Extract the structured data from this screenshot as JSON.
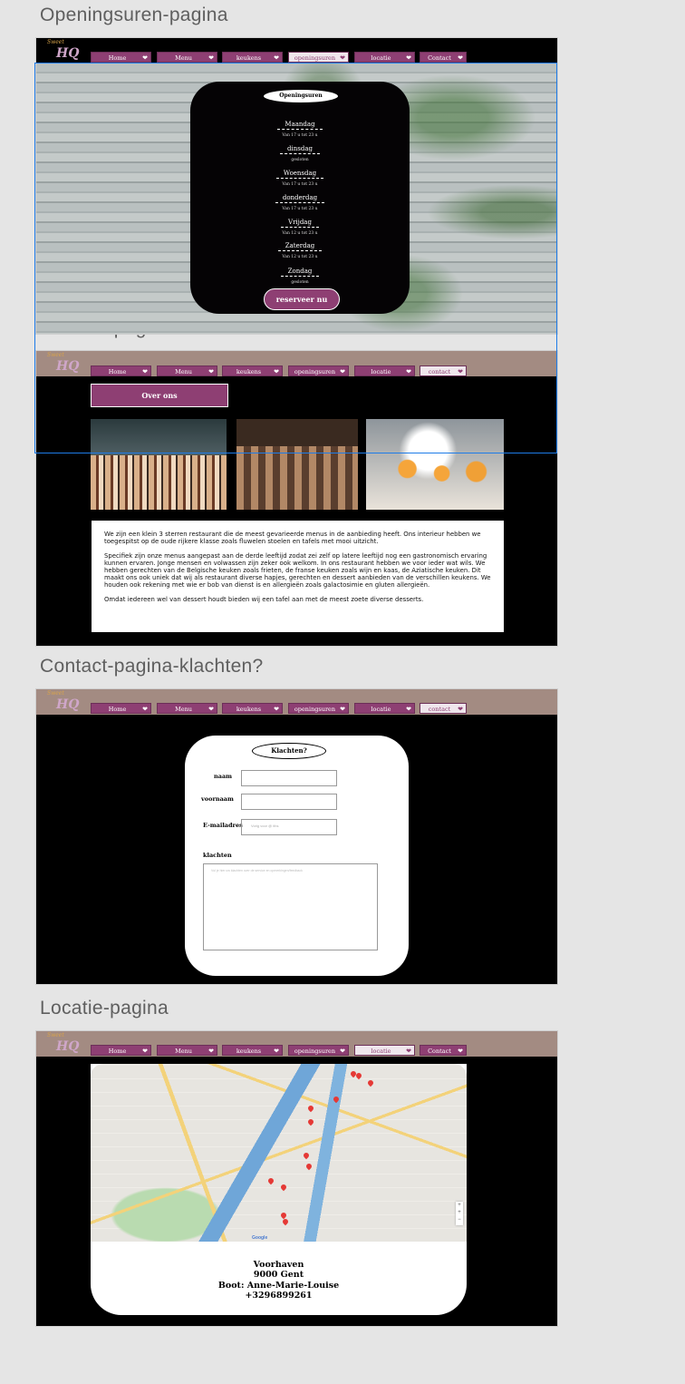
{
  "artboards": {
    "openingsuren": "Openingsuren-pagina",
    "over_ons": "Contact-pagina-over ons",
    "klachten": "Contact-pagina-klachten?",
    "locatie": "Locatie-pagina"
  },
  "logo": {
    "line1": "Sweet",
    "line2": "HQ"
  },
  "nav": {
    "home": "Home",
    "menu": "Menu",
    "keukens": "keukens",
    "openingsuren": "openingsuren",
    "locatie": "locatie",
    "contact_cap": "Contact",
    "contact_low": "contact"
  },
  "hours": {
    "title": "Openingsuren",
    "days": [
      {
        "name": "Maandag",
        "time": "Van 17 u tot 23 u"
      },
      {
        "name": "dinsdag",
        "time": "gesloten"
      },
      {
        "name": "Woensdag",
        "time": "Van 17 u tot 23 u"
      },
      {
        "name": "donderdag",
        "time": "Van 17 u tot 23 u"
      },
      {
        "name": "Vrijdag",
        "time": "Van 12 u tot 23 u"
      },
      {
        "name": "Zaterdag",
        "time": "Van 12 u tot 23 u"
      },
      {
        "name": "Zondag",
        "time": "gesloten"
      }
    ],
    "reserve": "reserveer nu"
  },
  "about": {
    "button": "Over ons",
    "p1": "We zijn een klein 3 sterren restaurant die de meest gevarieerde menus in de aanbieding heeft. Ons interieur hebben we toegespitst op de oude rijkere klasse zoals fluwelen stoelen en tafels met mooi uitzicht.",
    "p2": "Specifiek zijn onze menus aangepast aan de derde leeftijd zodat zei zelf op latere leeftijd nog een gastronomisch ervaring kunnen ervaren. Jonge mensen en volwassen zijn zeker ook welkom. In ons restaurant hebben we voor ieder wat wils. We hebben gerechten van de Belgische keuken zoals frieten, de franse keuken zoals wijn en kaas, de Aziatische keuken. Dit maakt ons ook uniek dat wij als restaurant diverse hapjes, gerechten en dessert aanbieden van de verschillen keukens. We houden ook rekening met wie er bob van dienst is en allergieën zoals galactosimie en gluten allergieën.",
    "p3": "Omdat iedereen wel van dessert houdt bieden wij een tafel aan met de meest zoete diverse desserts."
  },
  "complaints": {
    "title": "Klachten?",
    "naam": "naam",
    "voornaam": "voornaam",
    "email": "E-mailadres",
    "email_placeholder": "Vorig voor @ iths",
    "klachten": "klachten",
    "textarea_placeholder": "Vul je hier uw klachten over de service en opmerkingen/feedback"
  },
  "location": {
    "line1": "Voorhaven",
    "line2": "9000 Gent",
    "line3": "Boot: Anne-Marie-Louise",
    "line4": "+3296899261",
    "google": "Google"
  },
  "colors": {
    "accent": "#8e3f73",
    "taupe": "#a38b82",
    "selection": "#1e7ce8"
  }
}
